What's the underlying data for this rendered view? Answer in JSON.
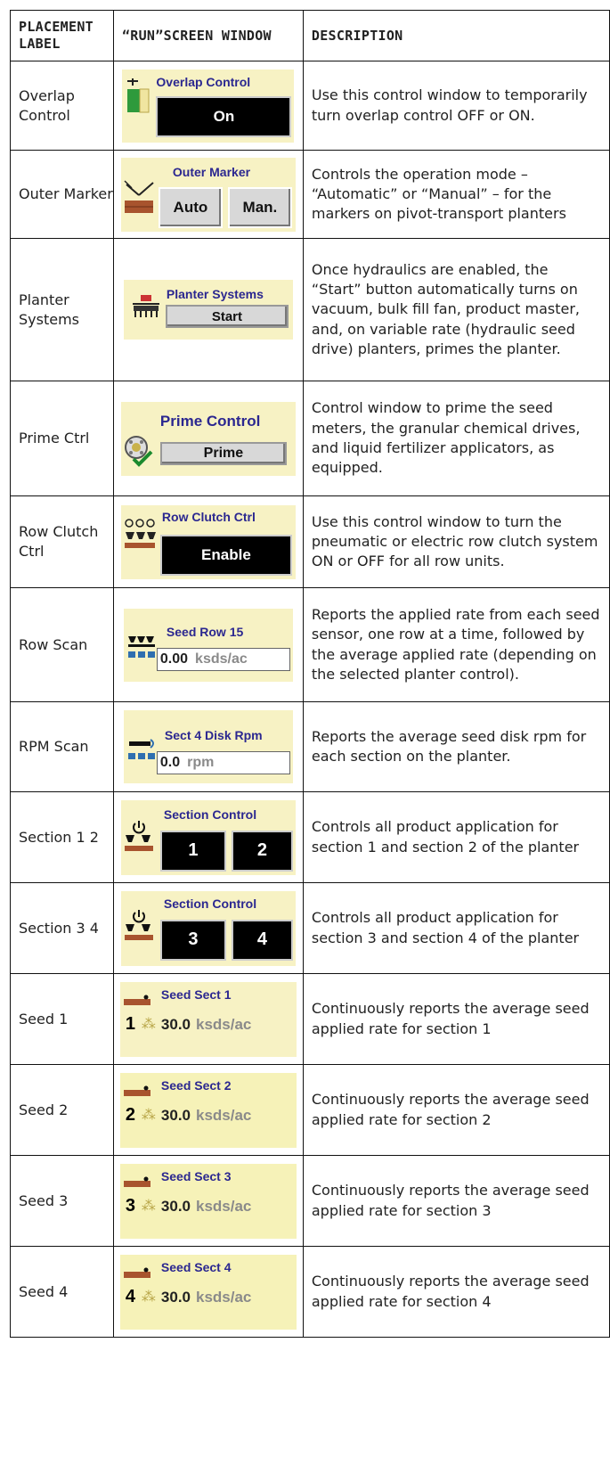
{
  "headers": {
    "label": "PLACEMENT LABEL",
    "window": "“RUN”SCREEN WINDOW",
    "desc": "DESCRIPTION"
  },
  "rows": [
    {
      "label": "Overlap Control",
      "title": "Overlap Control",
      "button": "On",
      "desc": "Use this control window to temporarily turn overlap control OFF or ON."
    },
    {
      "label": "Outer Marker",
      "title": "Outer Marker",
      "btn1": "Auto",
      "btn2": "Man.",
      "desc": "Controls the operation mode – “Automatic” or “Manual” – for the markers on pivot-transport planters"
    },
    {
      "label": "Planter Systems",
      "title": "Planter Systems",
      "button": "Start",
      "desc": "Once hydraulics are enabled, the “Start” button automatically turns on vacuum, bulk fill fan, product master, and, on variable rate (hydraulic seed drive) planters, primes the planter."
    },
    {
      "label": "Prime Ctrl",
      "title": "Prime Control",
      "button": "Prime",
      "desc": "Control window to prime the seed meters, the granular chemical drives, and liquid fertilizer applicators, as equipped."
    },
    {
      "label": "Row Clutch Ctrl",
      "title": "Row Clutch Ctrl",
      "button": "Enable",
      "desc": "Use this control window to turn the pneumatic or electric row clutch system ON or OFF for all row units."
    },
    {
      "label": "Row Scan",
      "title": "Seed Row 15",
      "value": "0.00",
      "unit": "ksds/ac",
      "desc": "Reports the applied rate from each seed sensor, one row at a time, followed by the average applied rate (depending on the selected planter control)."
    },
    {
      "label": "RPM Scan",
      "title": "Sect 4 Disk Rpm",
      "value": "0.0",
      "unit": "rpm",
      "desc": "Reports the average seed disk rpm for each section on the planter."
    },
    {
      "label": "Section 1 2",
      "title": "Section Control",
      "btn1": "1",
      "btn2": "2",
      "desc": "Controls all product application for section 1 and section 2 of the planter"
    },
    {
      "label": "Section 3 4",
      "title": "Section Control",
      "btn1": "3",
      "btn2": "4",
      "desc": "Controls all product application for section 3 and section 4 of the planter"
    },
    {
      "label": "Seed 1",
      "title": "Seed Sect 1",
      "digit": "1",
      "value": "30.0",
      "unit": "ksds/ac",
      "desc": "Continuously reports the average seed applied rate for section 1"
    },
    {
      "label": "Seed 2",
      "title": "Seed Sect 2",
      "digit": "2",
      "value": "30.0",
      "unit": "ksds/ac",
      "desc": "Continuously reports the average seed applied rate for section 2"
    },
    {
      "label": "Seed 3",
      "title": "Seed Sect 3",
      "digit": "3",
      "value": "30.0",
      "unit": "ksds/ac",
      "desc": "Continuously reports the average seed applied rate for section 3"
    },
    {
      "label": "Seed 4",
      "title": "Seed Sect 4",
      "digit": "4",
      "value": "30.0",
      "unit": "ksds/ac",
      "desc": "Continuously reports the average seed applied rate for section 4"
    }
  ],
  "colors": {
    "panel_bg": "#f7f2c4",
    "title_blue": "#2b2790",
    "dark_button": "#000000",
    "grey_button": "#d8d8d8"
  },
  "icons": [
    "overlap-icon",
    "marker-icon",
    "planter-icon",
    "prime-icon",
    "row-clutch-icon",
    "row-sensor-icon",
    "disk-rpm-icon",
    "section-icon",
    "seed-section-icon"
  ]
}
